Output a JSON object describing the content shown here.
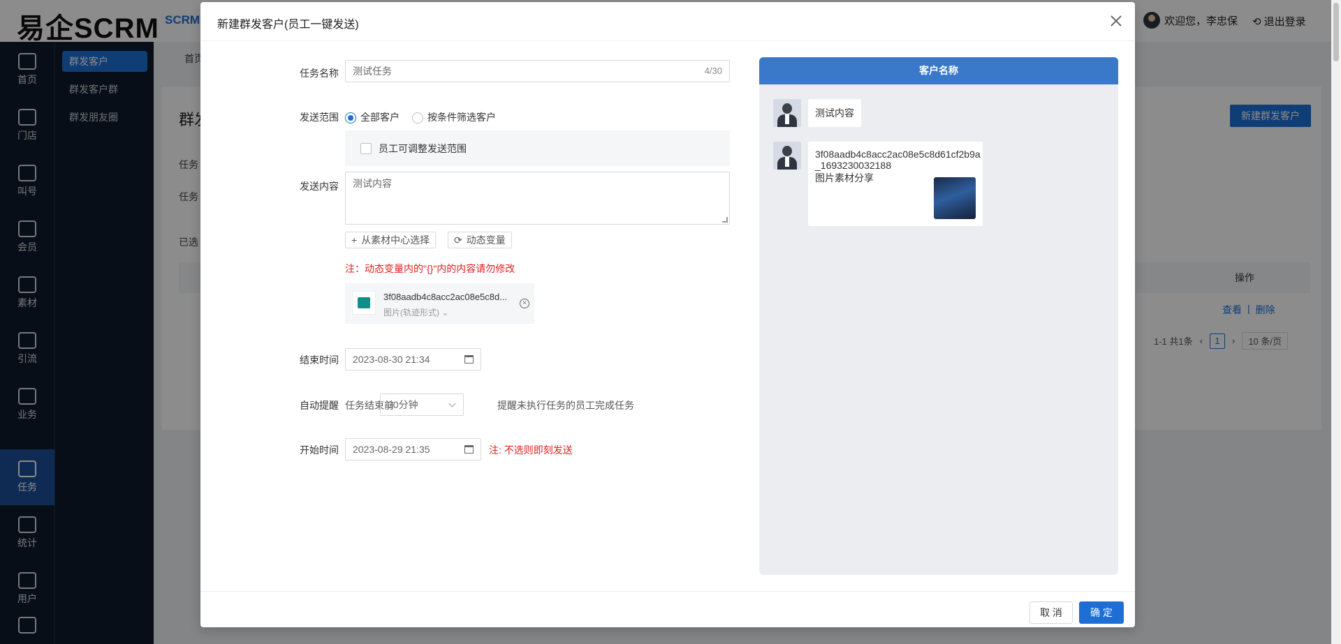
{
  "app": {
    "logo": "易企SCRM",
    "top_nav": "SCRM",
    "welcome": "欢迎您，李忠保",
    "logout": "退出登录"
  },
  "left_nav": [
    {
      "label": "首页",
      "icon": "home-icon"
    },
    {
      "label": "门店",
      "icon": "store-icon"
    },
    {
      "label": "叫号",
      "icon": "queue-icon"
    },
    {
      "label": "会员",
      "icon": "member-icon"
    },
    {
      "label": "素材",
      "icon": "image-icon"
    },
    {
      "label": "引流",
      "icon": "traffic-icon"
    },
    {
      "label": "业务",
      "icon": "bag-icon"
    },
    {
      "label": "任务",
      "icon": "pin-icon",
      "active": true
    },
    {
      "label": "统计",
      "icon": "chart-icon"
    },
    {
      "label": "用户",
      "icon": "user-icon"
    },
    {
      "label": "",
      "icon": "gear-icon"
    }
  ],
  "sub_nav": [
    {
      "label": "群发客户",
      "active": true
    },
    {
      "label": "群发客户群"
    },
    {
      "label": "群发朋友圈"
    }
  ],
  "background": {
    "tab": "首页",
    "card_title": "群发",
    "new_button": "新建群发客户",
    "filter_label_1": "任务",
    "filter_label_2": "任务",
    "selected_label": "已选",
    "op_header": "操作",
    "view": "查看",
    "delete": "删除",
    "pager_total": "1-1 共1条",
    "pager_page": "1",
    "pager_size": "10 条/页"
  },
  "modal": {
    "title": "新建群发客户(员工一键发送)",
    "task_name_label": "任务名称",
    "task_name_value": "测试任务",
    "task_name_count": "4/30",
    "scope_label": "发送范围",
    "scope_all": "全部客户",
    "scope_filter": "按条件筛选客户",
    "scope_adjust": "员工可调整发送范围",
    "content_label": "发送内容",
    "content_value": "测试内容",
    "btn_material": "从素材中心选择",
    "btn_dynamic": "动态变量",
    "dynamic_note": "注：动态变量内的\"{}\"内的内容请勿修改",
    "attachment_name": "3f08aadb4c8acc2ac08e5c8d...",
    "attachment_type": "图片(轨迹形式)",
    "end_time_label": "结束时间",
    "end_time_value": "2023-08-30 21:34",
    "remind_label": "自动提醒",
    "remind_prefix": "任务结束前",
    "remind_select": "30分钟",
    "remind_suffix": "提醒未执行任务的员工完成任务",
    "start_time_label": "开始时间",
    "start_time_value": "2023-08-29 21:35",
    "start_note": "注: 不选则即刻发送",
    "preview_header": "客户名称",
    "preview_msg_1": "测试内容",
    "preview_msg_2_line1": "3f08aadb4c8acc2ac08e5c8d61cf2b9a",
    "preview_msg_2_line2": "_1693230032188",
    "preview_msg_2_caption": "图片素材分享",
    "cancel": "取 消",
    "ok": "确 定"
  },
  "colors": {
    "primary": "#1d6fd6",
    "sidebar": "#0f1a2b",
    "warning_text": "#e02020",
    "preview_header": "#3a78c9"
  }
}
